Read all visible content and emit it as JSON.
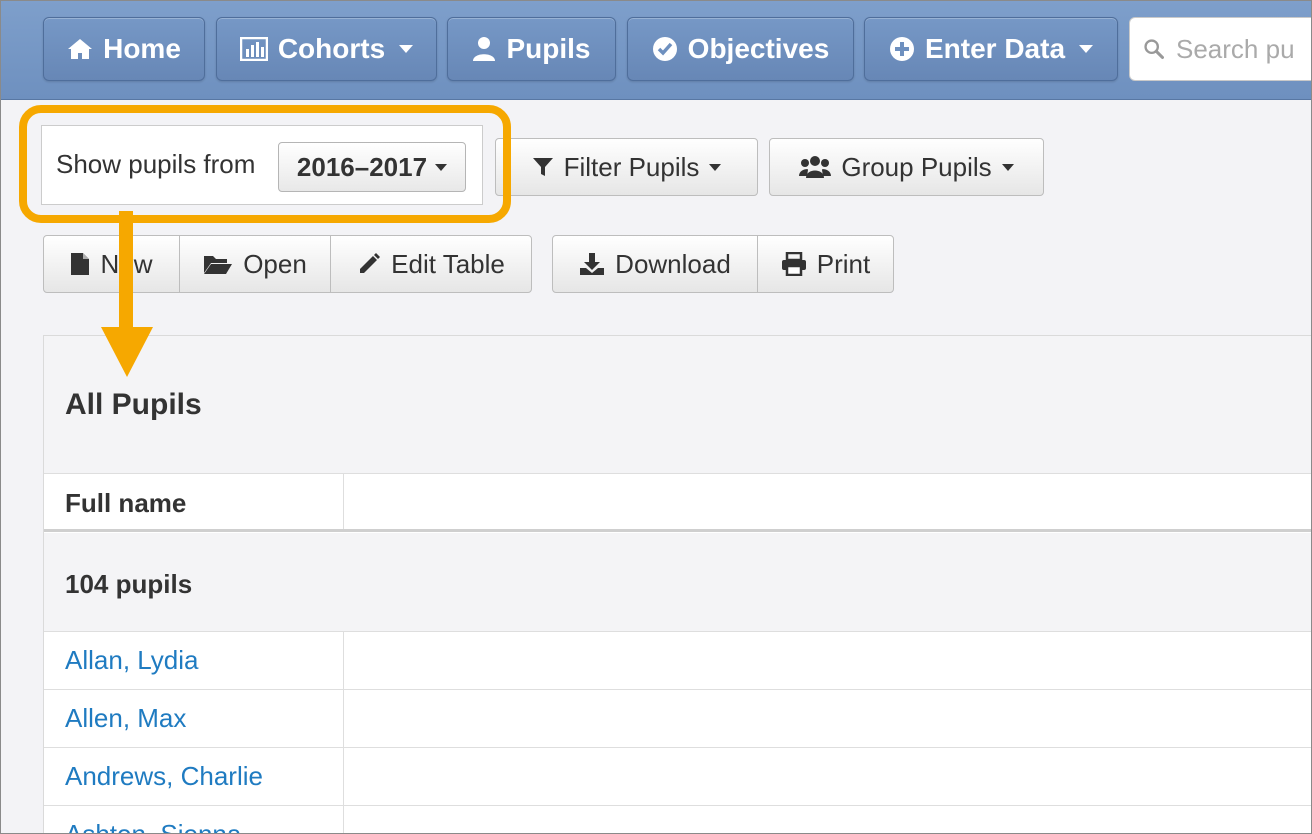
{
  "nav": {
    "home": "Home",
    "cohorts": "Cohorts",
    "pupils": "Pupils",
    "objectives": "Objectives",
    "enter_data": "Enter Data",
    "search_placeholder": "Search pu"
  },
  "filters": {
    "show_label": "Show pupils from",
    "year": "2016–2017",
    "filter_pupils": "Filter Pupils",
    "group_pupils": "Group Pupils"
  },
  "toolbar": {
    "new": "New",
    "open": "Open",
    "edit_table": "Edit Table",
    "download": "Download",
    "print": "Print"
  },
  "table": {
    "title": "All Pupils",
    "column_header": "Full name",
    "group_label": "104 pupils",
    "rows": [
      "Allan, Lydia",
      "Allen, Max",
      "Andrews, Charlie",
      "Ashton, Sienna"
    ]
  },
  "colors": {
    "nav_bg": "#7194c3",
    "highlight": "#f6a800",
    "link": "#1f7bc1"
  },
  "icons": [
    "home-icon",
    "chart-icon",
    "user-icon",
    "check-circle-icon",
    "plus-circle-icon",
    "search-icon",
    "filter-icon",
    "users-icon",
    "file-icon",
    "folder-open-icon",
    "pencil-icon",
    "download-icon",
    "print-icon",
    "arrow-down-annotation"
  ]
}
